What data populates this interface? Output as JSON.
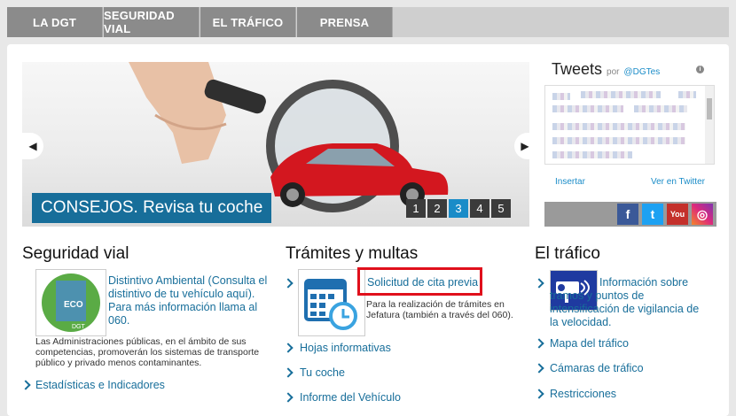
{
  "nav": {
    "items": [
      "LA DGT",
      "SEGURIDAD VIAL",
      "EL TRÁFICO",
      "PRENSA"
    ]
  },
  "slider": {
    "caption": "CONSEJOS. Revisa tu coche",
    "pages": [
      "1",
      "2",
      "3",
      "4",
      "5"
    ],
    "active_page": "3",
    "prev_icon": "chevron-left-icon",
    "next_icon": "chevron-right-icon"
  },
  "tweets": {
    "title": "Tweets",
    "by": "por",
    "handle": "@DGTes",
    "embed": "Insertar",
    "view": "Ver en Twitter"
  },
  "social": {
    "icons": [
      "facebook-icon",
      "twitter-icon",
      "youtube-icon",
      "instagram-icon"
    ]
  },
  "seguridad": {
    "title": "Seguridad vial",
    "feature_link": "Distintivo Ambiental (Consulta el distintivo de tu vehículo aquí). Para más información llama al 060.",
    "feature_desc": "Las Administraciones públicas, en el ámbito de sus competencias, promoverán los sistemas de transporte público y privado menos contaminantes.",
    "links": [
      "Estadísticas e Indicadores"
    ],
    "eco_label": "ECO",
    "dgt_label": "DGT"
  },
  "tramites": {
    "title": "Trámites y multas",
    "feature_link": "Solicitud de cita previa",
    "feature_desc": "Para la realización de trámites en Jefatura (también a través del 060).",
    "links": [
      "Hojas informativas",
      "Tu coche",
      "Informe del Vehículo"
    ]
  },
  "trafico": {
    "title": "El tráfico",
    "feature_link": "Información sobre tramos y puntos de intensificación de vigilancia de la velocidad.",
    "links": [
      "Mapa del tráfico",
      "Cámaras de tráfico",
      "Restricciones"
    ]
  },
  "colors": {
    "accent": "#176e9a",
    "active": "#1a8cc8",
    "highlight": "#e0101c",
    "nav": "#8b8b8b"
  }
}
